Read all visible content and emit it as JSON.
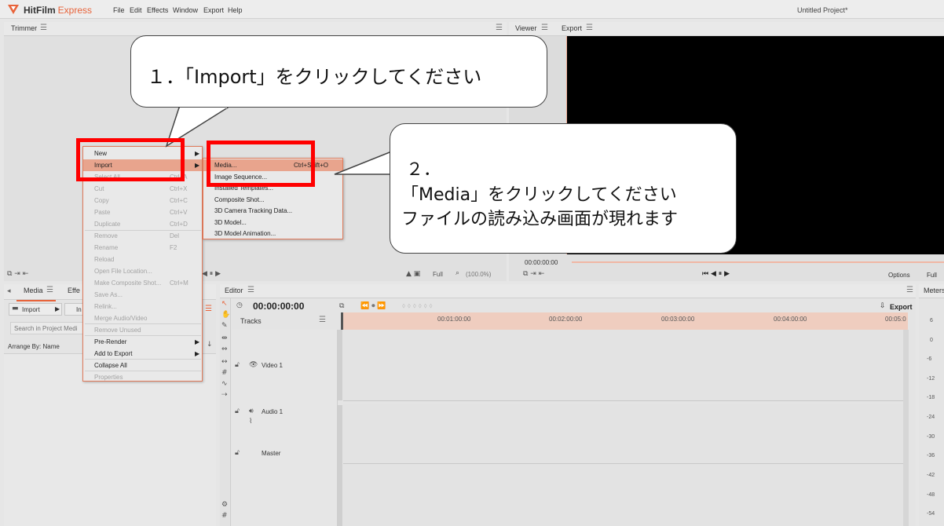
{
  "app": {
    "brand": "HitFilm",
    "brand_suffix": "Express",
    "menu": [
      "File",
      "Edit",
      "Effects",
      "Window",
      "Export",
      "Help"
    ],
    "project_title": "Untitled Project*"
  },
  "panels": {
    "trimmer_tab": "Trimmer",
    "viewer_tab": "Viewer",
    "export_tab": "Export",
    "media_tab": "Media",
    "effects_tab": "Effe",
    "editor_tab": "Editor",
    "meters_tab": "Meters"
  },
  "trimmer_controls": {
    "zoom_select": "Full",
    "zoom_percent": "(100.0%)"
  },
  "viewer": {
    "timecode": "00:00:00:00",
    "options_label": "Options",
    "full_label": "Full"
  },
  "media": {
    "import_label": "Import",
    "import2_label": "In",
    "search_placeholder": "Search in Project Medi",
    "arrange_label": "Arrange By: Name"
  },
  "editor": {
    "timecode": "00:00:00:00",
    "export_label": "Export",
    "tracks_label": "Tracks",
    "ruler_labels": [
      "00:01:00:00",
      "00:02:00:00",
      "00:03:00:00",
      "00:04:00:00",
      "00:05:0"
    ],
    "video_track": "Video 1",
    "audio_track": "Audio 1",
    "master_track": "Master"
  },
  "meters": {
    "labels": [
      "6",
      "0",
      "-6",
      "-12",
      "-18",
      "-24",
      "-30",
      "-36",
      "-42",
      "-48",
      "-54"
    ]
  },
  "context_menu": {
    "items": [
      {
        "label": "New",
        "shortcut": "",
        "arrow": true,
        "state": "en"
      },
      {
        "label": "Import",
        "shortcut": "",
        "arrow": true,
        "state": "hl"
      },
      {
        "label": "Select All",
        "shortcut": "Ctrl+A",
        "arrow": false,
        "state": "dis"
      },
      {
        "label": "Cut",
        "shortcut": "Ctrl+X",
        "arrow": false,
        "state": "dis"
      },
      {
        "label": "Copy",
        "shortcut": "Ctrl+C",
        "arrow": false,
        "state": "dis"
      },
      {
        "label": "Paste",
        "shortcut": "Ctrl+V",
        "arrow": false,
        "state": "dis"
      },
      {
        "label": "Duplicate",
        "shortcut": "Ctrl+D",
        "arrow": false,
        "state": "dis"
      },
      {
        "label": "Remove",
        "shortcut": "Del",
        "arrow": false,
        "state": "dis"
      },
      {
        "label": "Rename",
        "shortcut": "F2",
        "arrow": false,
        "state": "dis"
      },
      {
        "label": "Reload",
        "shortcut": "",
        "arrow": false,
        "state": "dis"
      },
      {
        "label": "Open File Location...",
        "shortcut": "",
        "arrow": false,
        "state": "dis"
      },
      {
        "label": "Make Composite Shot...",
        "shortcut": "Ctrl+M",
        "arrow": false,
        "state": "dis"
      },
      {
        "label": "Save As...",
        "shortcut": "",
        "arrow": false,
        "state": "dis"
      },
      {
        "label": "Relink...",
        "shortcut": "",
        "arrow": false,
        "state": "dis"
      },
      {
        "label": "Merge Audio/Video",
        "shortcut": "",
        "arrow": false,
        "state": "dis"
      },
      {
        "label": "Remove Unused",
        "shortcut": "",
        "arrow": false,
        "state": "dis"
      },
      {
        "label": "Pre-Render",
        "shortcut": "",
        "arrow": true,
        "state": "en"
      },
      {
        "label": "Add to Export",
        "shortcut": "",
        "arrow": true,
        "state": "en"
      },
      {
        "label": "Collapse All",
        "shortcut": "",
        "arrow": false,
        "state": "en"
      },
      {
        "label": "Properties",
        "shortcut": "",
        "arrow": false,
        "state": "dis"
      }
    ]
  },
  "import_submenu": {
    "items": [
      {
        "label": "Media...",
        "shortcut": "Ctrl+Shift+O",
        "state": "hl"
      },
      {
        "label": "Image Sequence...",
        "shortcut": "",
        "state": "en"
      },
      {
        "label": "Installed Templates...",
        "shortcut": "",
        "state": "en"
      },
      {
        "label": "Composite Shot...",
        "shortcut": "",
        "state": "en"
      },
      {
        "label": "3D Camera Tracking Data...",
        "shortcut": "",
        "state": "en"
      },
      {
        "label": "3D Model...",
        "shortcut": "",
        "state": "en"
      },
      {
        "label": "3D Model Animation...",
        "shortcut": "",
        "state": "en"
      }
    ]
  },
  "annotations": {
    "callout1": "１．「Import」をクリックしてください",
    "callout2_line1": "２．",
    "callout2_line2": "「Media」をクリックしてください",
    "callout2_line3": "ファイルの読み込み画面が現れます"
  },
  "colors": {
    "accent": "#e8633a",
    "highlight": "#e8a48d",
    "annotation_red": "#ff0000",
    "ruler": "#efcdbf"
  }
}
